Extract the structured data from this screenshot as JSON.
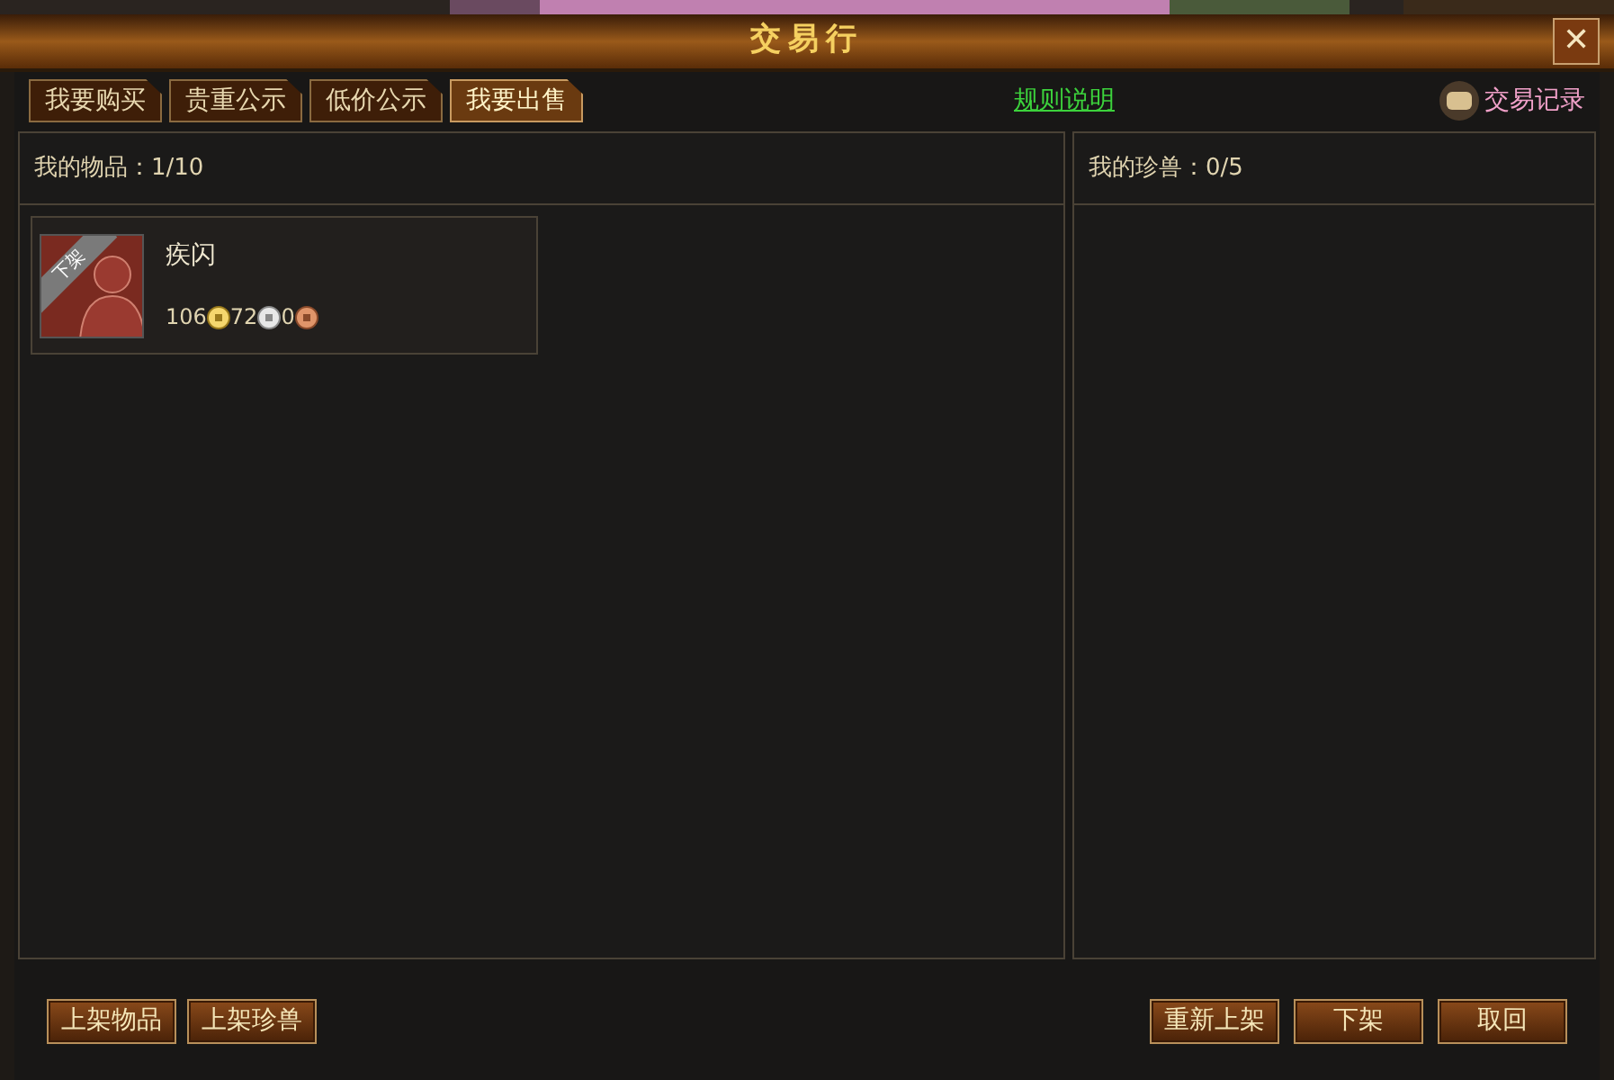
{
  "window": {
    "title": "交易行",
    "close": "✕"
  },
  "tabs": [
    {
      "label": "我要购买",
      "selected": false
    },
    {
      "label": "贵重公示",
      "selected": false
    },
    {
      "label": "低价公示",
      "selected": false
    },
    {
      "label": "我要出售",
      "selected": true
    }
  ],
  "rules_link": "规则说明",
  "history_link": "交易记录",
  "items_panel": {
    "title": "我的物品：1/10",
    "items": [
      {
        "name": "疾闪",
        "ribbon": "下架",
        "gold": "106",
        "silver": "72",
        "copper": "0"
      }
    ]
  },
  "pets_panel": {
    "title": "我的珍兽：0/5"
  },
  "left_buttons": [
    "上架物品",
    "上架珍兽"
  ],
  "right_buttons": [
    "重新上架",
    "下架",
    "取回"
  ]
}
